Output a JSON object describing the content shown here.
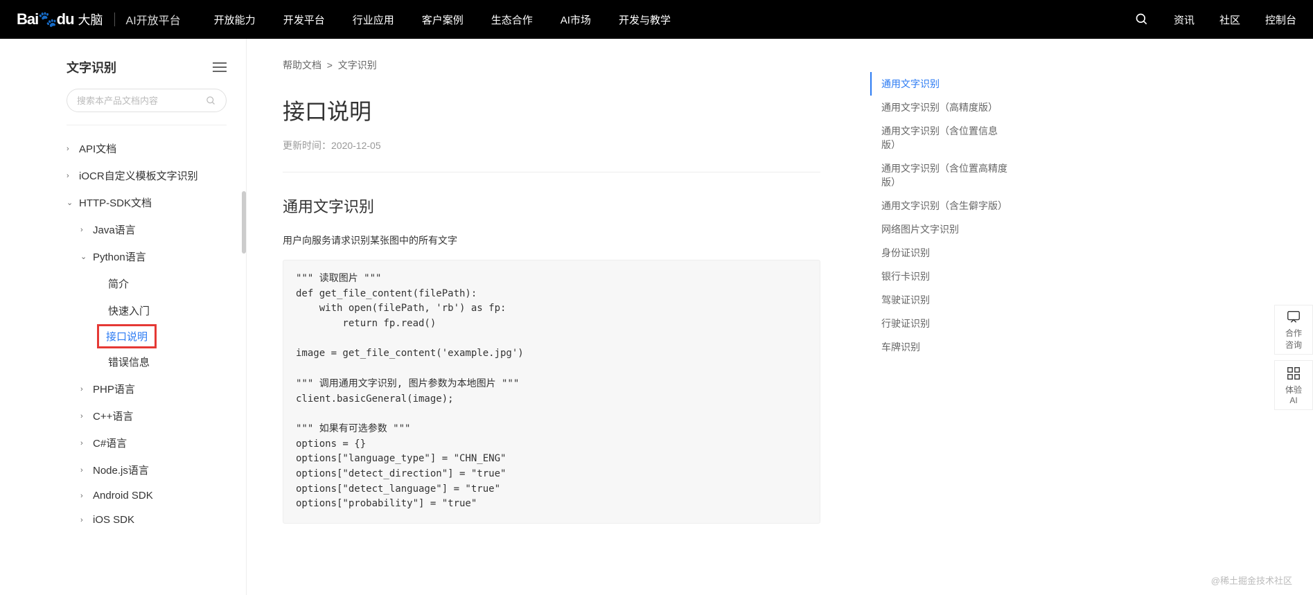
{
  "topnav": {
    "logo_baidu": "Bai",
    "logo_du": "du",
    "logo_brain": "大脑",
    "logo_sub": "AI开放平台",
    "links": [
      "开放能力",
      "开发平台",
      "行业应用",
      "客户案例",
      "生态合作",
      "AI市场",
      "开发与教学"
    ],
    "right": [
      "资讯",
      "社区",
      "控制台"
    ]
  },
  "sidebar": {
    "title": "文字识别",
    "search_placeholder": "搜索本产品文档内容",
    "items": {
      "api_docs": "API文档",
      "iocr": "iOCR自定义模板文字识别",
      "http_sdk": "HTTP-SDK文档",
      "java": "Java语言",
      "python": "Python语言",
      "intro": "简介",
      "quickstart": "快速入门",
      "api_desc": "接口说明",
      "error": "错误信息",
      "php": "PHP语言",
      "cpp": "C++语言",
      "csharp": "C#语言",
      "nodejs": "Node.js语言",
      "android": "Android SDK",
      "ios": "iOS SDK"
    }
  },
  "breadcrumb": {
    "a": "帮助文档",
    "sep": ">",
    "b": "文字识别"
  },
  "main": {
    "title": "接口说明",
    "update_label": "更新时间：",
    "update_date": "2020-12-05",
    "section_title": "通用文字识别",
    "section_desc": "用户向服务请求识别某张图中的所有文字",
    "code": "\"\"\" 读取图片 \"\"\"\ndef get_file_content(filePath):\n    with open(filePath, 'rb') as fp:\n        return fp.read()\n\nimage = get_file_content('example.jpg')\n\n\"\"\" 调用通用文字识别, 图片参数为本地图片 \"\"\"\nclient.basicGeneral(image);\n\n\"\"\" 如果有可选参数 \"\"\"\noptions = {}\noptions[\"language_type\"] = \"CHN_ENG\"\noptions[\"detect_direction\"] = \"true\"\noptions[\"detect_language\"] = \"true\"\noptions[\"probability\"] = \"true\""
  },
  "toc": [
    "通用文字识别",
    "通用文字识别（高精度版）",
    "通用文字识别（含位置信息版）",
    "通用文字识别（含位置高精度版）",
    "通用文字识别（含生僻字版）",
    "网络图片文字识别",
    "身份证识别",
    "银行卡识别",
    "驾驶证识别",
    "行驶证识别",
    "车牌识别"
  ],
  "float": {
    "consult": "合作\n咨询",
    "experience": "体验\nAI"
  },
  "watermark": "@稀土掘金技术社区"
}
